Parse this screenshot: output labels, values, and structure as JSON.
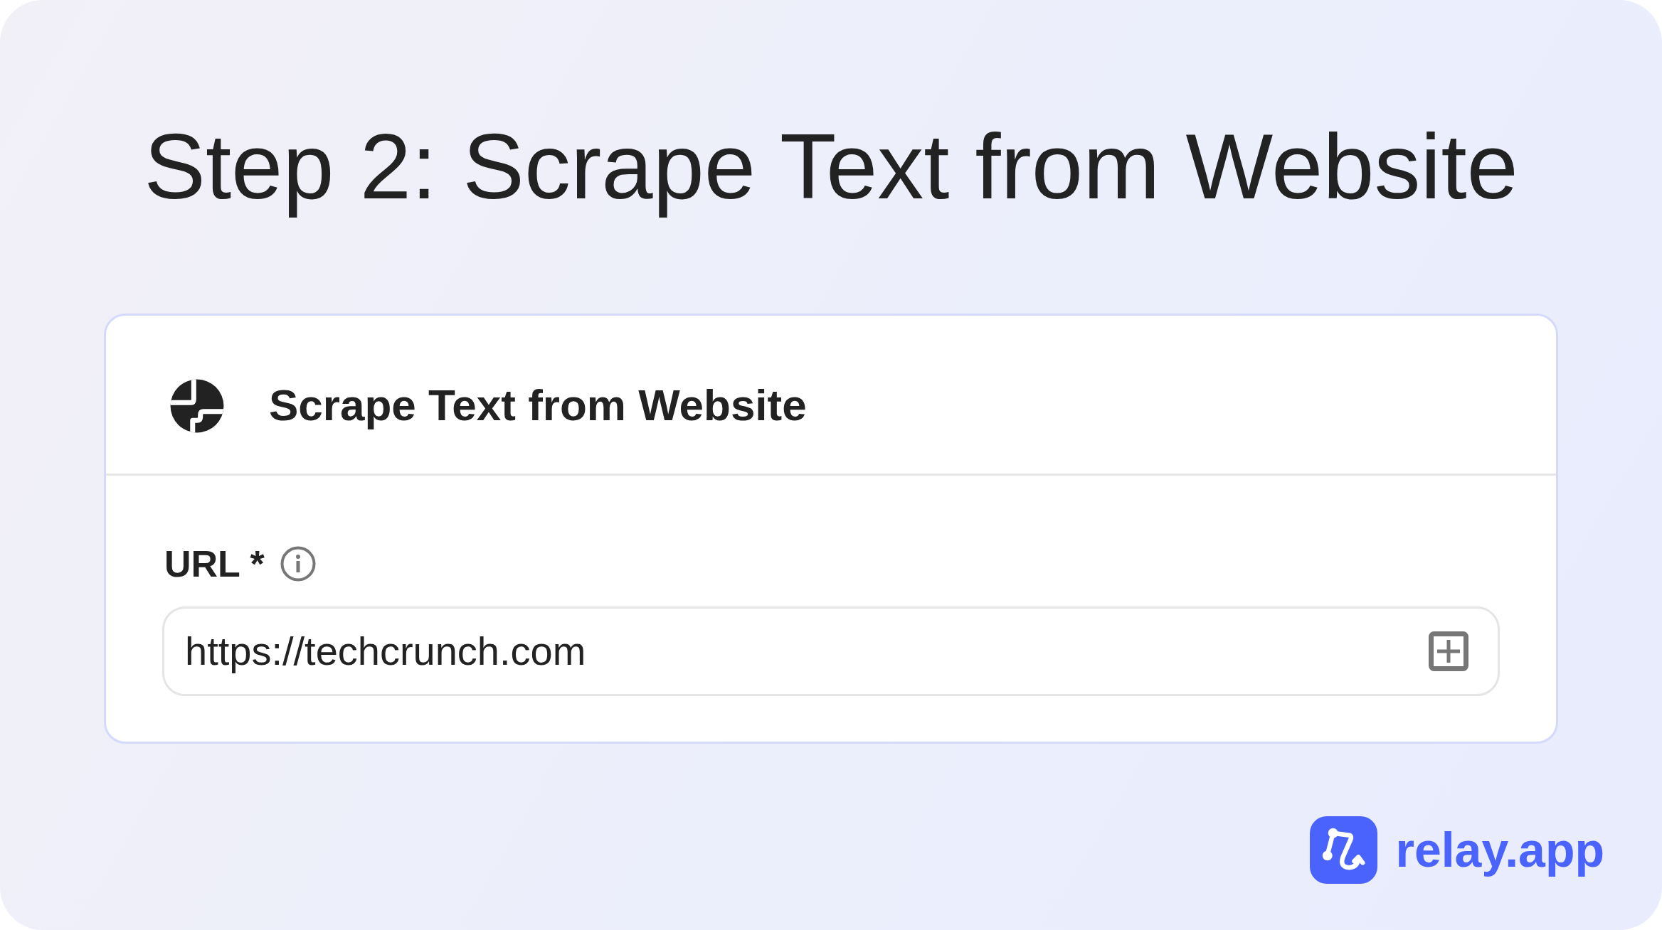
{
  "page": {
    "title": "Step 2: Scrape Text from Website"
  },
  "card": {
    "title": "Scrape Text from Website",
    "fields": [
      {
        "label": "URL *",
        "value": "https://techcrunch.com"
      }
    ]
  },
  "brand": {
    "name": "relay.app"
  }
}
